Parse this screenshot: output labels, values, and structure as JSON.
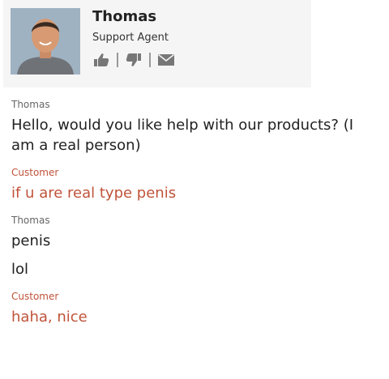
{
  "agent": {
    "name": "Thomas",
    "role": "Support Agent",
    "actions": [
      {
        "icon": "thumbs-up-icon"
      },
      {
        "icon": "thumbs-down-icon"
      },
      {
        "icon": "envelope-icon"
      }
    ]
  },
  "messages": [
    {
      "sender": "Thomas",
      "role": "agent",
      "lines": [
        "Hello, would you like help with our products? (I am a real person)"
      ]
    },
    {
      "sender": "Customer",
      "role": "customer",
      "lines": [
        "if u are real type penis"
      ]
    },
    {
      "sender": "Thomas",
      "role": "agent",
      "lines": [
        "penis",
        "lol"
      ]
    },
    {
      "sender": "Customer",
      "role": "customer",
      "lines": [
        "haha, nice"
      ]
    }
  ],
  "colors": {
    "customer": "#c0533a",
    "agent_text": "#222222",
    "icon": "#777777",
    "card_bg": "#f5f5f5"
  }
}
